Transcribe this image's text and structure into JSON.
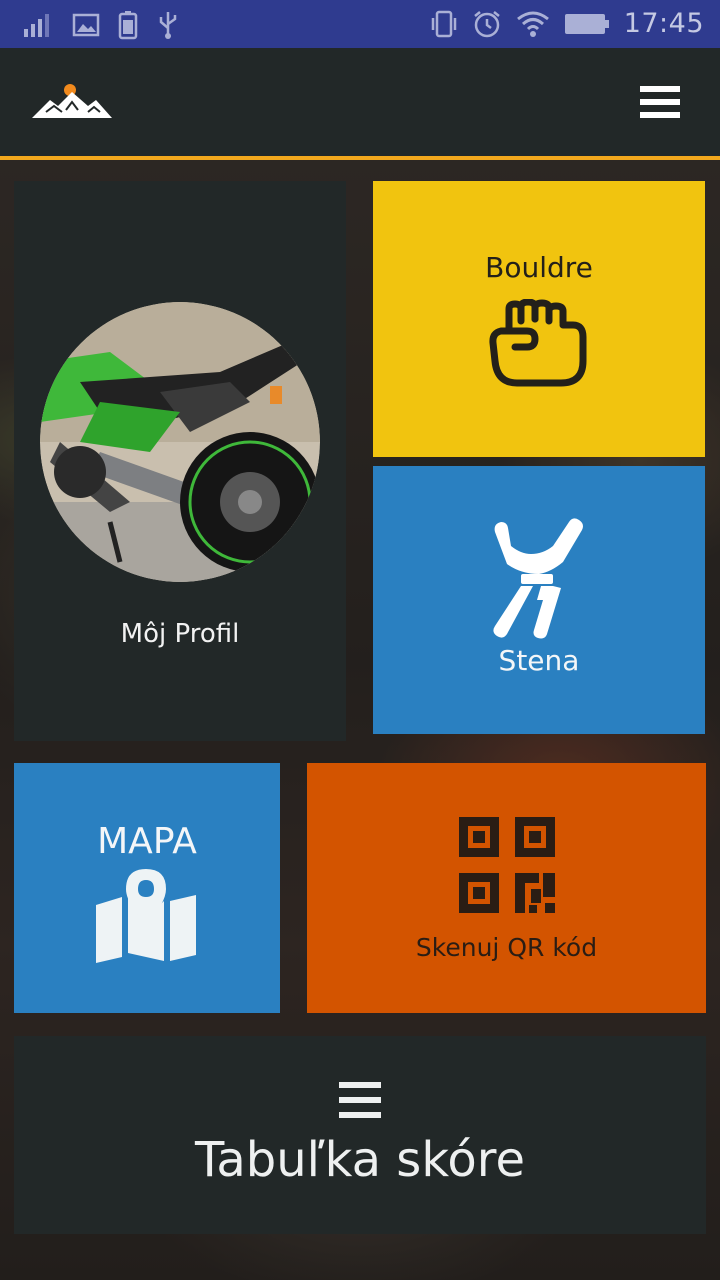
{
  "status_bar": {
    "time": "17:45",
    "left_icons": [
      "signal-icon",
      "image-icon",
      "battery-saver-icon",
      "usb-icon"
    ],
    "right_icons": [
      "vibrate-icon",
      "alarm-icon",
      "wifi-icon",
      "battery-icon"
    ]
  },
  "app_bar": {
    "logo_icon": "mountain-logo-icon",
    "menu_icon": "hamburger-menu-icon",
    "accent_color": "#f2a81d"
  },
  "tiles": {
    "profile": {
      "label": "Môj Profil",
      "color": "#222828"
    },
    "bouldre": {
      "label": "Bouldre",
      "icon": "fist-icon",
      "color": "#f1c40f"
    },
    "stena": {
      "label": "Stena",
      "icon": "climber-harness-icon",
      "color": "#2a80c1"
    },
    "mapa": {
      "label": "MAPA",
      "icon": "map-pin-icon",
      "color": "#2a80c1"
    },
    "qr": {
      "label": "Skenuj QR kód",
      "icon": "qr-code-icon",
      "color": "#d35400"
    },
    "score": {
      "label": "Tabuľka skóre",
      "icon": "list-icon",
      "color": "#222828"
    }
  }
}
